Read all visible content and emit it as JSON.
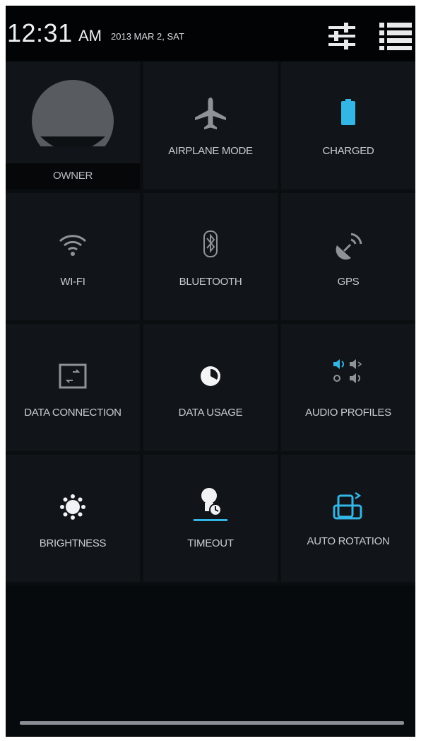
{
  "status_bar": {
    "time": "12:31",
    "ampm": "AM",
    "date": "2013 MAR 2, SAT",
    "icons": [
      "sliders-icon",
      "list-icon"
    ]
  },
  "tiles": {
    "owner": {
      "label": "OWNER",
      "icon": "avatar-icon"
    },
    "airplane_mode": {
      "label": "AIRPLANE MODE",
      "icon": "airplane-icon"
    },
    "charged": {
      "label": "CHARGED",
      "icon": "battery-icon"
    },
    "wifi": {
      "label": "WI-FI",
      "icon": "wifi-icon"
    },
    "bluetooth": {
      "label": "BLUETOOTH",
      "icon": "bluetooth-icon"
    },
    "gps": {
      "label": "GPS",
      "icon": "satellite-icon"
    },
    "data_connection": {
      "label": "DATA CONNECTION",
      "icon": "data-connection-icon"
    },
    "data_usage": {
      "label": "DATA USAGE",
      "icon": "pie-chart-icon"
    },
    "audio_profiles": {
      "label": "AUDIO PROFILES",
      "icon": "audio-profiles-icon"
    },
    "brightness": {
      "label": "BRIGHTNESS",
      "icon": "sun-icon"
    },
    "timeout": {
      "label": "TIMEOUT",
      "icon": "timeout-icon"
    },
    "auto_rotation": {
      "label": "AUTO ROTATION",
      "icon": "rotation-icon"
    }
  },
  "colors": {
    "background": "#0b0e11",
    "tile": "#111519",
    "accent": "#33b5e5",
    "icon_gray": "#9a9ea3",
    "label": "#c9ccd0"
  }
}
